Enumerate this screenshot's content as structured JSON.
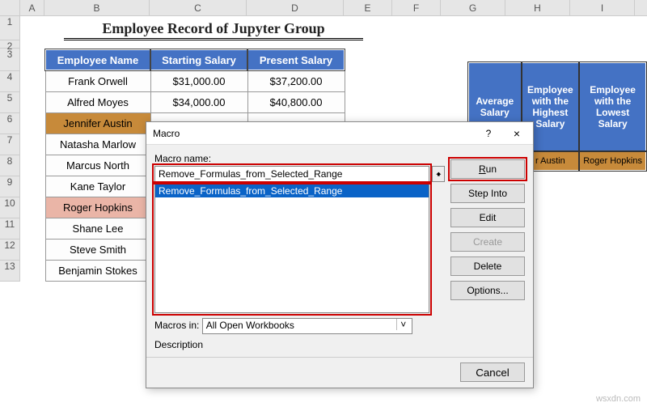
{
  "columns": [
    "A",
    "B",
    "C",
    "D",
    "E",
    "F",
    "G",
    "H",
    "I"
  ],
  "rowNumbers": [
    "1",
    "2",
    "3",
    "4",
    "5",
    "6",
    "7",
    "8",
    "9",
    "10",
    "11",
    "12",
    "13"
  ],
  "title": "Employee Record of Jupyter Group",
  "table": {
    "headers": [
      "Employee Name",
      "Starting Salary",
      "Present Salary"
    ],
    "rows": [
      {
        "name": "Frank Orwell",
        "start": "$31,000.00",
        "present": "$37,200.00",
        "cls": ""
      },
      {
        "name": "Alfred Moyes",
        "start": "$34,000.00",
        "present": "$40,800.00",
        "cls": ""
      },
      {
        "name": "Jennifer Austin",
        "start": "",
        "present": "",
        "cls": "orange"
      },
      {
        "name": "Natasha Marlow",
        "start": "",
        "present": "",
        "cls": ""
      },
      {
        "name": "Marcus North",
        "start": "",
        "present": "",
        "cls": ""
      },
      {
        "name": "Kane Taylor",
        "start": "",
        "present": "",
        "cls": ""
      },
      {
        "name": "Roger Hopkins",
        "start": "",
        "present": "",
        "cls": "pink"
      },
      {
        "name": "Shane Lee",
        "start": "",
        "present": "",
        "cls": ""
      },
      {
        "name": "Steve Smith",
        "start": "",
        "present": "",
        "cls": ""
      },
      {
        "name": "Benjamin Stokes",
        "start": "",
        "present": "",
        "cls": ""
      }
    ]
  },
  "summary": {
    "headers": [
      "Average Salary",
      "Employee with the Highest Salary",
      "Employee with the Lowest Salary"
    ],
    "values": [
      "",
      "r Austin",
      "Roger Hopkins"
    ]
  },
  "dialog": {
    "title": "Macro",
    "help": "?",
    "close": "×",
    "macroNameLabel": "Macro name:",
    "macroName": "Remove_Formulas_from_Selected_Range",
    "listSelected": "Remove_Formulas_from_Selected_Range",
    "macrosInLabel": "Macros in:",
    "macrosIn": "All Open Workbooks",
    "descriptionLabel": "Description",
    "buttons": {
      "run": "Run",
      "stepInto": "Step Into",
      "edit": "Edit",
      "create": "Create",
      "delete": "Delete",
      "options": "Options...",
      "cancel": "Cancel"
    }
  },
  "watermark": "wsxdn.com"
}
